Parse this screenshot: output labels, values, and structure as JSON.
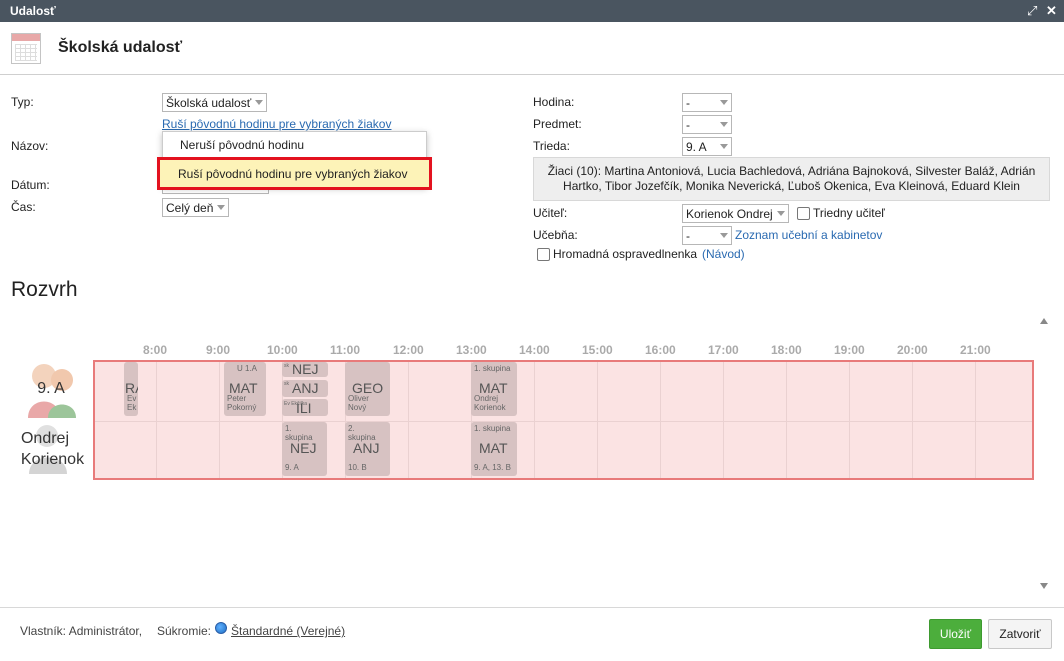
{
  "window": {
    "title": "Udalosť"
  },
  "header": {
    "title": "Školská udalosť"
  },
  "left_form": {
    "typ_label": "Typ:",
    "typ_value": "Školská udalosť",
    "typ_link": "Ruší pôvodnú hodinu pre vybraných žiakov",
    "nazov_label": "Názov:",
    "datum_label": "Dátum:",
    "cas_label": "Čas:",
    "cas_value": "Celý deň",
    "dropdown_options": [
      "Neruší pôvodnú hodinu",
      "Ruší pôvodnú hodinu pre vybraných žiakov"
    ]
  },
  "right_form": {
    "hodina_label": "Hodina:",
    "hodina_value": "-",
    "predmet_label": "Predmet:",
    "predmet_value": "-",
    "trieda_label": "Trieda:",
    "trieda_value": "9. A",
    "students_line1": "Žiaci (10): Martina Antoniová, Lucia Bachledová, Adriána Bajnoková, Silvester Baláž, Adrián",
    "students_line2": "Hartko, Tibor Jozefčík, Monika Neverická, Ľuboš Okenica, Eva Kleinová, Eduard Klein",
    "ucitel_label": "Učiteľ:",
    "ucitel_value": "Korienok Ondrej",
    "triedny_label": "Triedny učiteľ",
    "ucebna_label": "Učebňa:",
    "ucebna_value": "-",
    "ucebna_link": "Zoznam učební a kabinetov",
    "hromadna_label": "Hromadná ospravedlnenka",
    "navod_link": "(Návod)"
  },
  "schedule": {
    "title": "Rozvrh",
    "hours": [
      "8:00",
      "9:00",
      "10:00",
      "11:00",
      "12:00",
      "13:00",
      "14:00",
      "15:00",
      "16:00",
      "17:00",
      "18:00",
      "19:00",
      "20:00",
      "21:00"
    ],
    "row1_label": "9. A",
    "row2_label_1": "Ondrej",
    "row2_label_2": "Korienok",
    "cards_row1": [
      {
        "subject": "RA",
        "lines": [
          "Ev",
          "Ek"
        ]
      },
      {
        "subject": "MAT",
        "top": "U 1.A",
        "lines": [
          "Peter",
          "Pokorný"
        ]
      },
      {
        "subject": "NEJ",
        "top": "sk"
      },
      {
        "subject": "ANJ",
        "top": "sk"
      },
      {
        "subject": "ILI",
        "top": "Ev Ekčilka"
      },
      {
        "subject": "GEO",
        "lines": [
          "Oliver",
          "Nový"
        ]
      },
      {
        "subject": "MAT",
        "top": "1. skupina",
        "lines": [
          "Ondrej",
          "Korienok"
        ]
      }
    ],
    "cards_row2": [
      {
        "subject": "NEJ",
        "top": "1. skupina",
        "bottom": "9. A"
      },
      {
        "subject": "ANJ",
        "top": "2. skupina",
        "bottom": "10. B"
      },
      {
        "subject": "MAT",
        "top": "1. skupina",
        "bottom": "9. A, 13. B"
      }
    ]
  },
  "footer": {
    "owner": "Vlastník: Administrátor,",
    "privacy_label": "Súkromie:",
    "privacy_value": "Štandardné (Verejné)",
    "save": "Uložiť",
    "close": "Zatvoriť"
  },
  "colors": {
    "titlebar": "#4a5560",
    "save_button": "#4cae3c",
    "link": "#2a6ab1",
    "highlight_border": "#e3121f",
    "schedule_bg": "#fbe3e3"
  }
}
